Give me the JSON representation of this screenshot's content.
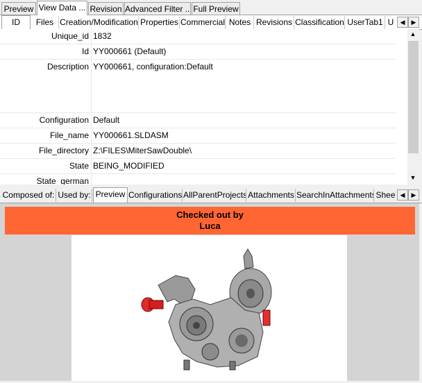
{
  "top_tabs": [
    "Preview",
    "View Data ...",
    "Revision",
    "Advanced Filter ...",
    "Full Preview"
  ],
  "sub_tabs": [
    "ID",
    "Files",
    "Creation/Modification",
    "Properties",
    "Commercial",
    "Notes",
    "Revisions",
    "Classification",
    "UserTab1",
    "U"
  ],
  "properties": [
    {
      "label": "Unique_id",
      "value": "1832"
    },
    {
      "label": "Id",
      "value": "YY000661 (Default)"
    },
    {
      "label": "Description",
      "value": "YY000661, configuration:Default"
    },
    {
      "label": "Configuration",
      "value": "Default"
    },
    {
      "label": "File_name",
      "value": "YY000661.SLDASM"
    },
    {
      "label": "File_directory",
      "value": "Z:\\FILES\\MiterSawDouble\\"
    },
    {
      "label": "State",
      "value": "BEING_MODIFIED"
    },
    {
      "label": "State_german",
      "value": ""
    }
  ],
  "bottom_tabs": [
    "Composed of:",
    "Used by:",
    "Preview",
    "Configurations",
    "AllParentProjects",
    "Attachments",
    "SearchInAttachments",
    "Shee"
  ],
  "banner": {
    "line1": "Checked out by",
    "line2": "Luca",
    "color": "#ff6633"
  },
  "icons": {
    "scroll_left": "chevron-left-icon",
    "scroll_right": "chevron-right-icon"
  }
}
